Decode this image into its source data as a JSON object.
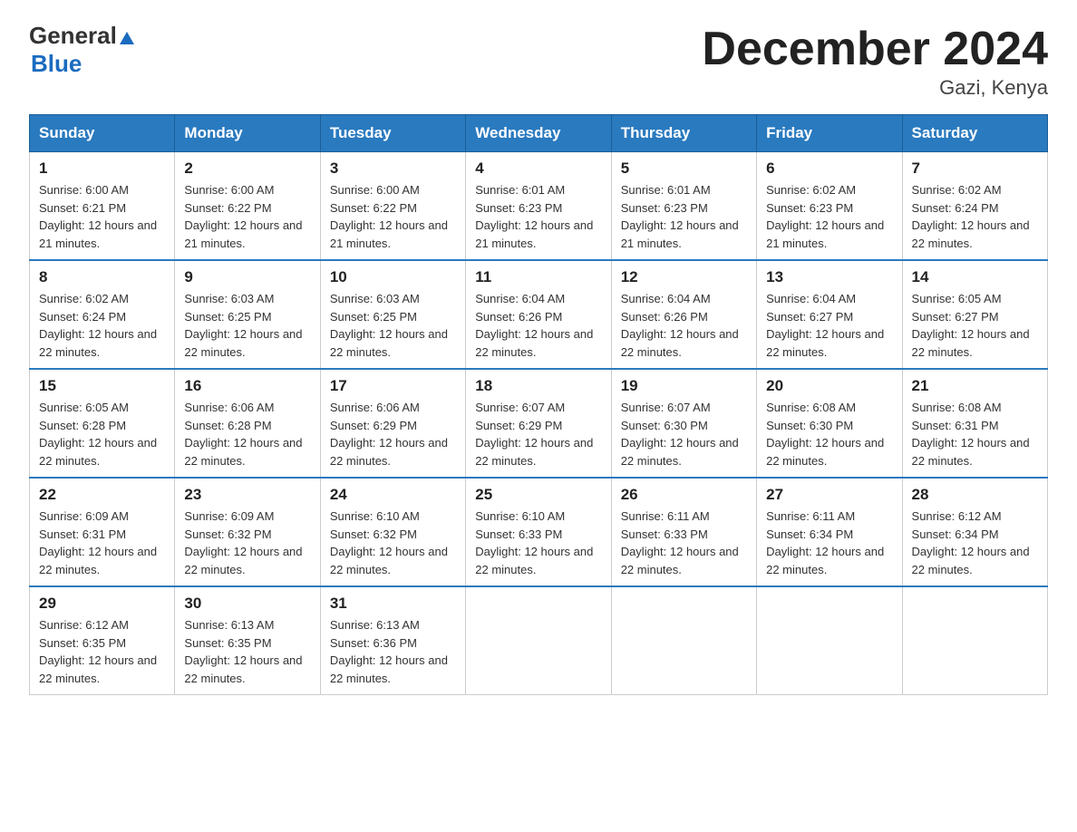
{
  "header": {
    "logo_general": "General",
    "logo_blue": "Blue",
    "title": "December 2024",
    "subtitle": "Gazi, Kenya"
  },
  "columns": [
    "Sunday",
    "Monday",
    "Tuesday",
    "Wednesday",
    "Thursday",
    "Friday",
    "Saturday"
  ],
  "weeks": [
    [
      {
        "day": "1",
        "sunrise": "6:00 AM",
        "sunset": "6:21 PM",
        "daylight": "12 hours and 21 minutes."
      },
      {
        "day": "2",
        "sunrise": "6:00 AM",
        "sunset": "6:22 PM",
        "daylight": "12 hours and 21 minutes."
      },
      {
        "day": "3",
        "sunrise": "6:00 AM",
        "sunset": "6:22 PM",
        "daylight": "12 hours and 21 minutes."
      },
      {
        "day": "4",
        "sunrise": "6:01 AM",
        "sunset": "6:23 PM",
        "daylight": "12 hours and 21 minutes."
      },
      {
        "day": "5",
        "sunrise": "6:01 AM",
        "sunset": "6:23 PM",
        "daylight": "12 hours and 21 minutes."
      },
      {
        "day": "6",
        "sunrise": "6:02 AM",
        "sunset": "6:23 PM",
        "daylight": "12 hours and 21 minutes."
      },
      {
        "day": "7",
        "sunrise": "6:02 AM",
        "sunset": "6:24 PM",
        "daylight": "12 hours and 22 minutes."
      }
    ],
    [
      {
        "day": "8",
        "sunrise": "6:02 AM",
        "sunset": "6:24 PM",
        "daylight": "12 hours and 22 minutes."
      },
      {
        "day": "9",
        "sunrise": "6:03 AM",
        "sunset": "6:25 PM",
        "daylight": "12 hours and 22 minutes."
      },
      {
        "day": "10",
        "sunrise": "6:03 AM",
        "sunset": "6:25 PM",
        "daylight": "12 hours and 22 minutes."
      },
      {
        "day": "11",
        "sunrise": "6:04 AM",
        "sunset": "6:26 PM",
        "daylight": "12 hours and 22 minutes."
      },
      {
        "day": "12",
        "sunrise": "6:04 AM",
        "sunset": "6:26 PM",
        "daylight": "12 hours and 22 minutes."
      },
      {
        "day": "13",
        "sunrise": "6:04 AM",
        "sunset": "6:27 PM",
        "daylight": "12 hours and 22 minutes."
      },
      {
        "day": "14",
        "sunrise": "6:05 AM",
        "sunset": "6:27 PM",
        "daylight": "12 hours and 22 minutes."
      }
    ],
    [
      {
        "day": "15",
        "sunrise": "6:05 AM",
        "sunset": "6:28 PM",
        "daylight": "12 hours and 22 minutes."
      },
      {
        "day": "16",
        "sunrise": "6:06 AM",
        "sunset": "6:28 PM",
        "daylight": "12 hours and 22 minutes."
      },
      {
        "day": "17",
        "sunrise": "6:06 AM",
        "sunset": "6:29 PM",
        "daylight": "12 hours and 22 minutes."
      },
      {
        "day": "18",
        "sunrise": "6:07 AM",
        "sunset": "6:29 PM",
        "daylight": "12 hours and 22 minutes."
      },
      {
        "day": "19",
        "sunrise": "6:07 AM",
        "sunset": "6:30 PM",
        "daylight": "12 hours and 22 minutes."
      },
      {
        "day": "20",
        "sunrise": "6:08 AM",
        "sunset": "6:30 PM",
        "daylight": "12 hours and 22 minutes."
      },
      {
        "day": "21",
        "sunrise": "6:08 AM",
        "sunset": "6:31 PM",
        "daylight": "12 hours and 22 minutes."
      }
    ],
    [
      {
        "day": "22",
        "sunrise": "6:09 AM",
        "sunset": "6:31 PM",
        "daylight": "12 hours and 22 minutes."
      },
      {
        "day": "23",
        "sunrise": "6:09 AM",
        "sunset": "6:32 PM",
        "daylight": "12 hours and 22 minutes."
      },
      {
        "day": "24",
        "sunrise": "6:10 AM",
        "sunset": "6:32 PM",
        "daylight": "12 hours and 22 minutes."
      },
      {
        "day": "25",
        "sunrise": "6:10 AM",
        "sunset": "6:33 PM",
        "daylight": "12 hours and 22 minutes."
      },
      {
        "day": "26",
        "sunrise": "6:11 AM",
        "sunset": "6:33 PM",
        "daylight": "12 hours and 22 minutes."
      },
      {
        "day": "27",
        "sunrise": "6:11 AM",
        "sunset": "6:34 PM",
        "daylight": "12 hours and 22 minutes."
      },
      {
        "day": "28",
        "sunrise": "6:12 AM",
        "sunset": "6:34 PM",
        "daylight": "12 hours and 22 minutes."
      }
    ],
    [
      {
        "day": "29",
        "sunrise": "6:12 AM",
        "sunset": "6:35 PM",
        "daylight": "12 hours and 22 minutes."
      },
      {
        "day": "30",
        "sunrise": "6:13 AM",
        "sunset": "6:35 PM",
        "daylight": "12 hours and 22 minutes."
      },
      {
        "day": "31",
        "sunrise": "6:13 AM",
        "sunset": "6:36 PM",
        "daylight": "12 hours and 22 minutes."
      },
      {
        "day": "",
        "sunrise": "",
        "sunset": "",
        "daylight": ""
      },
      {
        "day": "",
        "sunrise": "",
        "sunset": "",
        "daylight": ""
      },
      {
        "day": "",
        "sunrise": "",
        "sunset": "",
        "daylight": ""
      },
      {
        "day": "",
        "sunrise": "",
        "sunset": "",
        "daylight": ""
      }
    ]
  ]
}
